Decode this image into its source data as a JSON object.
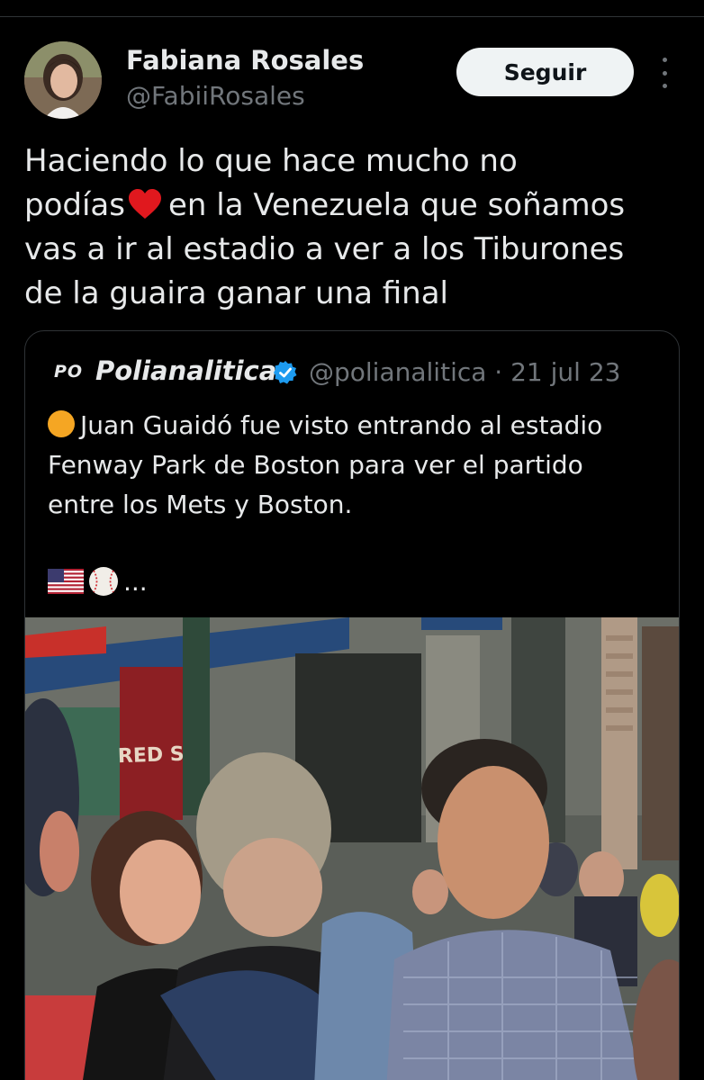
{
  "author": {
    "name": "Fabiana Rosales",
    "handle": "@FabiiRosales",
    "avatar_icon": "profile-photo"
  },
  "follow_button": {
    "label": "Seguir"
  },
  "more_icon": "more-vertical-icon",
  "tweet": {
    "lines": [
      "Haciendo lo que hace mucho no",
      "podías",
      "en la Venezuela que soñamos",
      "vas a ir al estadio a ver a los Tiburones",
      "de la guaira ganar una final"
    ],
    "emoji": "heart-emoji"
  },
  "quoted_tweet": {
    "logo_text": "PO",
    "author_name": "Polianalitica",
    "verified_icon": "verified-badge-icon",
    "handle_and_date": "@polianalitica · 21 jul 23",
    "lines": [
      "Juan Guaidó fue visto entrando al estadio",
      "Fenway Park de Boston para ver el partido",
      "entre los Mets y Boston."
    ],
    "leading_emoji": "orange-circle-emoji",
    "trailing_emojis": [
      "us-flag-emoji",
      "baseball-emoji"
    ],
    "truncation": "...",
    "photo_sign_text": "RED S"
  },
  "colors": {
    "background": "#000000",
    "text": "#e7e9ea",
    "secondary": "#71767b",
    "border": "#2f3336",
    "verified": "#1d9bf0",
    "heart": "#e0181e"
  }
}
